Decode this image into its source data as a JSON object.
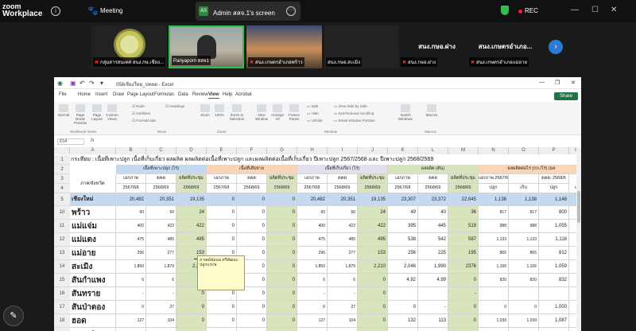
{
  "zoom": {
    "logo_line1": "zoom",
    "logo_line2": "Workplace",
    "meeting_label": "Meeting",
    "share_avatar": "AS",
    "share_label": "Admin สสจ.1's screen",
    "rec_label": "REC"
  },
  "participants": [
    {
      "name": "กลุ่มสารสนเทศ สนง.กษ.เชียง..."
    },
    {
      "name": "Pariyaporn สสจ1"
    },
    {
      "name": "สนง.เกษตรอำเภอพร้าว"
    },
    {
      "name": "สนง.กษอ.สะเมิง"
    },
    {
      "big": "สนง.กษอ.ฝาง",
      "name": "สนง.กษอ.ฝาง"
    },
    {
      "big": "สนง.เกษตรอำเภอ...",
      "name": "สนง.เกษตรอำเภอแม่อาย"
    }
  ],
  "excel": {
    "file_name": "058เชียงใหม่_ปทลด - Excel",
    "tabs": [
      "File",
      "Home",
      "Insert",
      "Draw",
      "Page Layout",
      "Formulas",
      "Data",
      "Review",
      "View",
      "Help",
      "Acrobat"
    ],
    "active_tab": "View",
    "share_label": "Share",
    "ribbon": {
      "buttons": [
        "Normal",
        "Page Break Preview",
        "Page Layout",
        "Custom Views",
        "Zoom",
        "100%",
        "Zoom to Selection",
        "New Window",
        "Arrange All",
        "Freeze Panes",
        "Switch Windows",
        "Macros"
      ],
      "checks": [
        "Ruler",
        "Gridlines",
        "Formula Bar",
        "Headings"
      ],
      "window_opts": [
        "Split",
        "Hide",
        "Unhide",
        "View Side by Side",
        "Synchronous Scrolling",
        "Reset Window Position"
      ],
      "groups": [
        "Workbook Views",
        "Show",
        "Zoom",
        "Window",
        "Macros"
      ]
    },
    "name_box": "D14",
    "fx": "fx",
    "columns": [
      "A",
      "B",
      "C",
      "D",
      "E",
      "F",
      "G",
      "H",
      "I",
      "J",
      "K",
      "L",
      "M",
      "N",
      "O",
      "P",
      "Q"
    ],
    "title_row": "กระทียม : เนื้อที่เพาะปลูก เนื้อที่เก็บเกี่ยว ผลผลิต ผลผลิตต่อเนื้อที่เพาะปลูก และผลผลิตต่อเนื้อที่เก็บเกี่ยว ปีเพาะปลูก 2567/2568 และ ปีเพาะปลูก 2568/2569",
    "group_headers": [
      "เนื้อที่เพาะปลูก (ไร่)",
      "เนื้อที่เสียหาย",
      "เนื้อที่เก็บเกี่ยว (ไร่)",
      "ผลผลิต (ตัน)",
      "ผลผลิตต่อไร่ (กก./ไร่) (ผล"
    ],
    "sub_header_col_a": "ภาค/จังหวัด",
    "sub_headers": [
      "เอกภาพ",
      "ตคต",
      "ผลิตที่ประชุม",
      "เอกภาพ",
      "ตคต",
      "ผลิตที่ประชุม",
      "เอกภาพ",
      "ตคต",
      "ผลิตที่ประชุม",
      "เอกภาพ",
      "ตคต",
      "ผลิตที่ประชุม",
      "เอกภาพ 2567/68",
      "",
      "ตคต. 2568/6"
    ],
    "year_row": [
      "2567/68",
      "2568/69",
      "2568/69",
      "2567/68",
      "2568/69",
      "2568/69",
      "2567/68",
      "2568/69",
      "2568/69",
      "2567/68",
      "2568/69",
      "2568/69",
      "ปลูก",
      "เก็บ",
      "ปลูก",
      "เก็"
    ],
    "rows": [
      {
        "num": "5",
        "name": "เชียงใหม่",
        "vals": [
          "20,482",
          "20,351",
          "19,135",
          "0",
          "0",
          "0",
          "20,482",
          "20,351",
          "19,135",
          "23,307",
          "23,372",
          "22,645",
          "1,138",
          "1,138",
          "1,148",
          "1,"
        ]
      },
      {
        "num": "10",
        "name": "พร้าว",
        "vals": [
          "60",
          "50",
          "24",
          "0",
          "0",
          "0",
          "60",
          "50",
          "24",
          "49",
          "40",
          "36",
          "817",
          "817",
          "800",
          ""
        ]
      },
      {
        "num": "11",
        "name": "แม่แจ่ม",
        "vals": [
          "400",
          "422",
          "422",
          "0",
          "0",
          "0",
          "400",
          "422",
          "422",
          "395",
          "445",
          "519",
          "988",
          "988",
          "1,055",
          "1,"
        ]
      },
      {
        "num": "12",
        "name": "แม่แตง",
        "vals": [
          "475",
          "485",
          "495",
          "0",
          "0",
          "0",
          "475",
          "485",
          "495",
          "538",
          "542",
          "587",
          "1,133",
          "1,133",
          "1,118",
          "1,"
        ]
      },
      {
        "num": "13",
        "name": "แม่อาย",
        "vals": [
          "296",
          "277",
          "153",
          "0",
          "0",
          "0",
          "296",
          "277",
          "153",
          "256",
          "225",
          "195",
          "865",
          "865",
          "812",
          ""
        ]
      },
      {
        "num": "14",
        "name": "สะเมิง",
        "vals": [
          "1,850",
          "1,879",
          "2,210",
          "0",
          "0",
          "0",
          "1,850",
          "1,879",
          "2,210",
          "2,046",
          "1,990",
          "2376",
          "1,106",
          "1,106",
          "1,059",
          "1,"
        ]
      },
      {
        "num": "15",
        "name": "สันกำแพง",
        "vals": [
          "6",
          "6",
          "0",
          "0",
          "0",
          "0",
          "6",
          "6",
          "0",
          "4.92",
          "4.99",
          "0",
          "820",
          "820",
          "832",
          ""
        ]
      },
      {
        "num": "16",
        "name": "สันทราย",
        "vals": [
          "-",
          "-",
          "0",
          "0",
          "0",
          "0",
          "-",
          "-",
          "0",
          "",
          "",
          "-",
          "",
          "",
          "",
          ""
        ]
      },
      {
        "num": "17",
        "name": "สันป่าตอง",
        "vals": [
          "0",
          "27",
          "0",
          "0",
          "0",
          "0",
          "0",
          "27",
          "0",
          "0",
          "-",
          "0",
          "0",
          "0",
          "1,000",
          ""
        ]
      },
      {
        "num": "18",
        "name": "ฮอด",
        "vals": [
          "127",
          "104",
          "0",
          "0",
          "0",
          "0",
          "127",
          "104",
          "0",
          "132",
          "113",
          "0",
          "1,039",
          "1,039",
          "1,087",
          "1,"
        ]
      },
      {
        "num": "19",
        "name": "ดอยเต่า",
        "vals": [
          "97",
          "",
          "",
          "",
          "",
          "",
          "",
          "",
          "",
          "",
          "",
          "",
          "",
          "",
          "",
          ""
        ]
      }
    ],
    "comment_text": "ภาษณ์ช่อนม ศรีพัฒนะ: ปลูกแรกษ"
  }
}
